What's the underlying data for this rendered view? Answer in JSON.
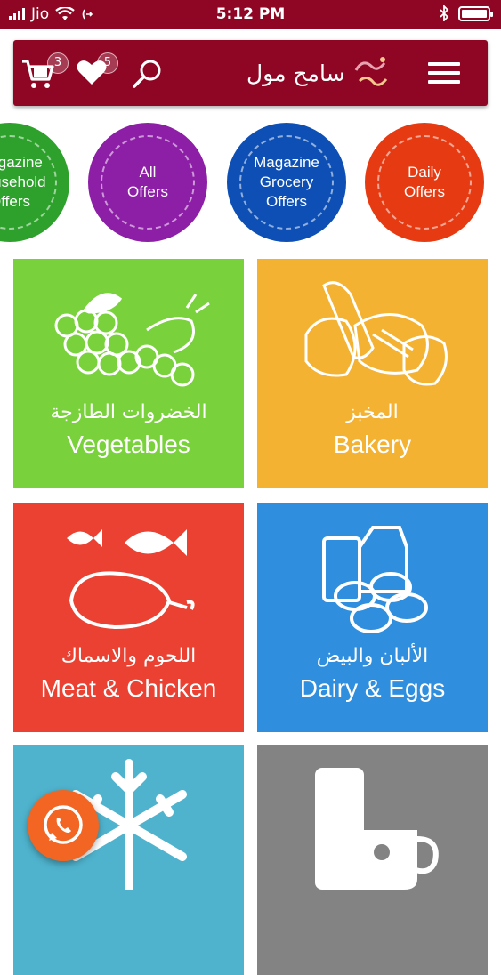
{
  "status_bar": {
    "carrier": "Jio",
    "time": "5:12 PM"
  },
  "header": {
    "cart_count": "3",
    "wishlist_count": "5",
    "app_name": "سامح مول"
  },
  "offers": [
    {
      "label": "Magazine\nHousehold\nOffers",
      "color": "#2ea12c"
    },
    {
      "label": "All\nOffers",
      "color": "#8d1ea6"
    },
    {
      "label": "Magazine\nGrocery\nOffers",
      "color": "#0d4fb4"
    },
    {
      "label": "Daily\nOffers",
      "color": "#e63b12"
    }
  ],
  "categories": [
    {
      "arabic": "الخضروات الطازجة",
      "english": "Vegetables",
      "color": "#79d13b",
      "icon": "vegetables-icon"
    },
    {
      "arabic": "المخبز",
      "english": "Bakery",
      "color": "#f4b233",
      "icon": "bread-icon"
    },
    {
      "arabic": "اللحوم والاسماك",
      "english": "Meat & Chicken",
      "color": "#ea4132",
      "icon": "meat-fish-icon"
    },
    {
      "arabic": "الألبان والبيض",
      "english": "Dairy & Eggs",
      "color": "#2f8fde",
      "icon": "dairy-eggs-icon"
    },
    {
      "arabic": "",
      "english": "",
      "color": "#4fb3cd",
      "icon": "snowflake-icon"
    },
    {
      "arabic": "",
      "english": "",
      "color": "#838383",
      "icon": "cup-icon"
    }
  ],
  "colors": {
    "brand": "#8e0623",
    "whatsapp_button": "#f26522"
  }
}
